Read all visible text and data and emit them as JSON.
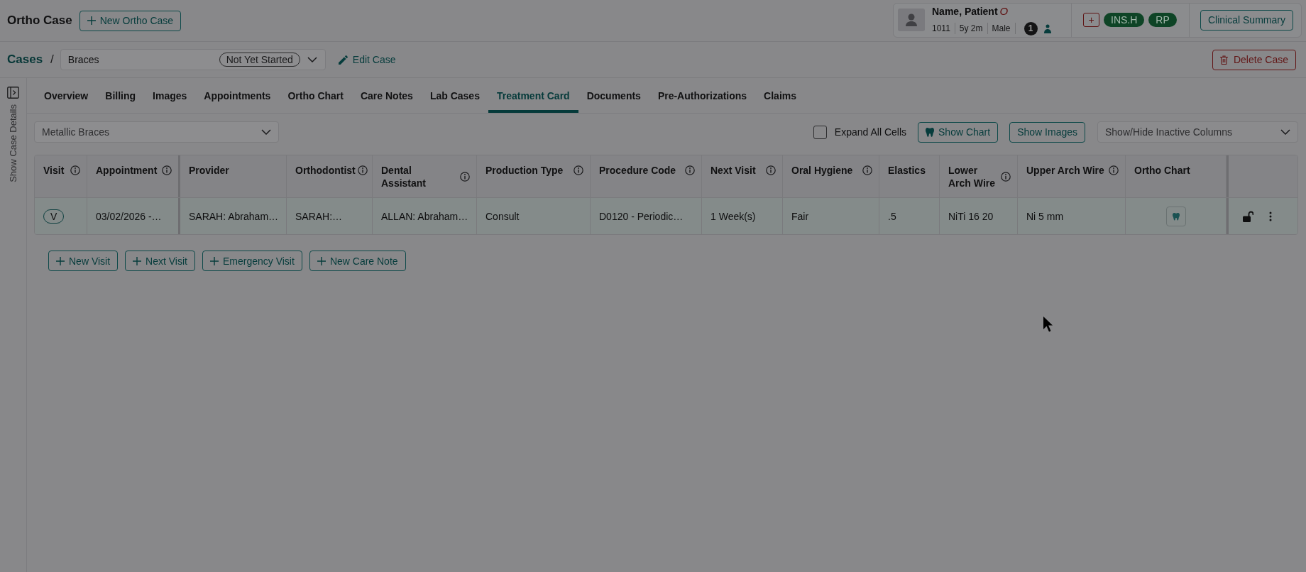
{
  "header": {
    "title": "Ortho Case",
    "new_button": "New Ortho Case"
  },
  "patient": {
    "name": "Name, Patient",
    "flag": "O",
    "details": [
      "1011",
      "5y 2m",
      "Male"
    ],
    "badge": "1",
    "add_button": "+",
    "tags": [
      "INS.H",
      "RP"
    ],
    "summary_button": "Clinical Summary"
  },
  "breadcrumb": {
    "root": "Cases",
    "separator": "/",
    "case": "Braces",
    "status": "Not Yet Started",
    "edit_button": "Edit Case",
    "delete_button": "Delete Case"
  },
  "side_panel": {
    "label": "Show Case Details"
  },
  "tabs": [
    {
      "label": "Overview",
      "selected": false
    },
    {
      "label": "Billing",
      "selected": false
    },
    {
      "label": "Images",
      "selected": false
    },
    {
      "label": "Appointments",
      "selected": false
    },
    {
      "label": "Ortho Chart",
      "selected": false
    },
    {
      "label": "Care Notes",
      "selected": false
    },
    {
      "label": "Lab Cases",
      "selected": false
    },
    {
      "label": "Treatment Card",
      "selected": true
    },
    {
      "label": "Documents",
      "selected": false
    },
    {
      "label": "Pre-Authorizations",
      "selected": false
    },
    {
      "label": "Claims",
      "selected": false
    }
  ],
  "toolbar": {
    "appliance": "Metallic Braces",
    "expand_all": {
      "label": "Expand All Cells",
      "checked": false
    },
    "buttons": [
      {
        "label": "Show Chart",
        "kind": "icon"
      },
      {
        "label": "Show Images",
        "kind": "text"
      }
    ],
    "columns_select": {
      "placeholder": "Show/Hide Inactive Columns"
    }
  },
  "table": {
    "columns": [
      {
        "label": "Visit",
        "info": true
      },
      {
        "label": "Appointment",
        "info": true
      },
      {
        "label": "Provider",
        "info": false
      },
      {
        "label": "Orthodontist",
        "info": true
      },
      {
        "label": "Dental Assistant",
        "info": true
      },
      {
        "label": "Production Type",
        "info": true
      },
      {
        "label": "Procedure Code",
        "info": true
      },
      {
        "label": "Next Visit",
        "info": true
      },
      {
        "label": "Oral Hygiene",
        "info": true
      },
      {
        "label": "Elastics",
        "info": false
      },
      {
        "label": "Lower Arch Wire",
        "info": true
      },
      {
        "label": "Upper Arch Wire",
        "info": true
      },
      {
        "label": "Ortho Chart",
        "info": false
      }
    ],
    "rows": [
      {
        "locked": false,
        "cells": [
          {
            "kind": "badge",
            "text": "V"
          },
          {
            "kind": "text",
            "text": "03/02/2026 -…"
          },
          {
            "kind": "text",
            "text": "SARAH: Abraham…"
          },
          {
            "kind": "text",
            "text": "SARAH:…"
          },
          {
            "kind": "text",
            "text": "ALLAN: Abraham…"
          },
          {
            "kind": "text",
            "text": "Consult"
          },
          {
            "kind": "text",
            "text": "D0120 - Periodic…"
          },
          {
            "kind": "text",
            "text": "1 Week(s)"
          },
          {
            "kind": "text",
            "text": "Fair"
          },
          {
            "kind": "text",
            "text": ".5"
          },
          {
            "kind": "text",
            "text": "NiTi 16 20"
          },
          {
            "kind": "text",
            "text": "Ni 5 mm"
          },
          {
            "kind": "chart_button"
          }
        ]
      }
    ]
  },
  "actions": [
    "New Visit",
    "Next Visit",
    "Emergency Visit",
    "New Care Note"
  ]
}
